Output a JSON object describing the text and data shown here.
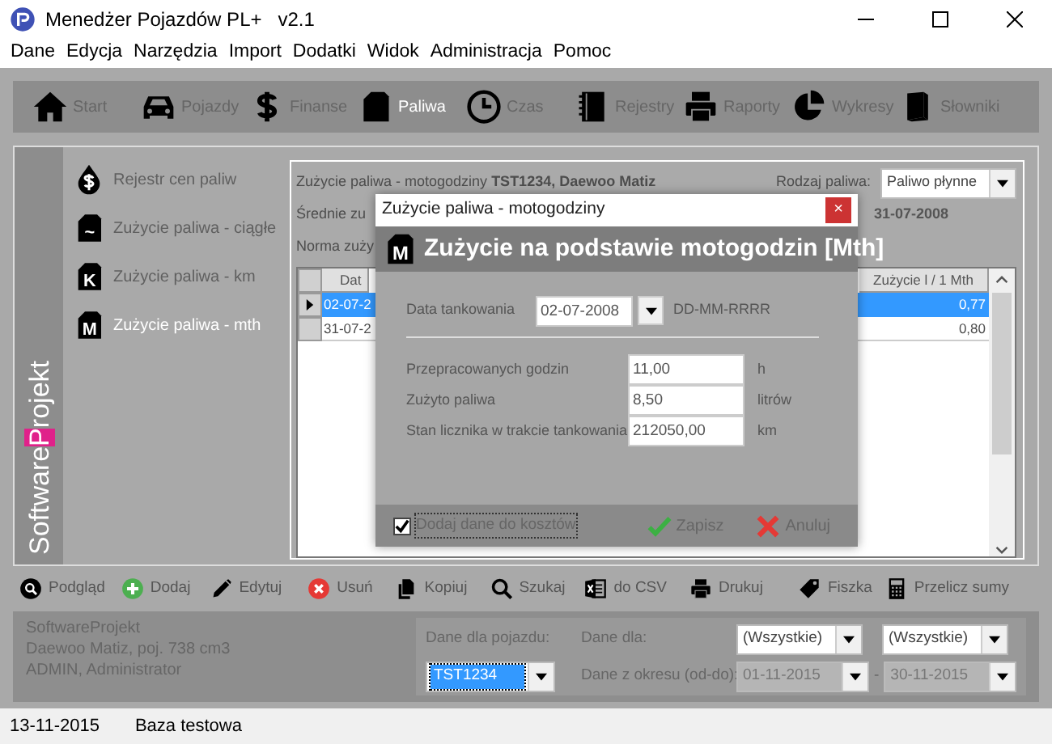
{
  "window": {
    "title": "Menedżer Pojazdów PL+",
    "version": "v2.1"
  },
  "menu": [
    "Dane",
    "Edycja",
    "Narzędzia",
    "Import",
    "Dodatki",
    "Widok",
    "Administracja",
    "Pomoc"
  ],
  "toolbar": [
    {
      "label": "Start",
      "selected": false
    },
    {
      "label": "Pojazdy",
      "selected": false
    },
    {
      "label": "Finanse",
      "selected": false
    },
    {
      "label": "Paliwa",
      "selected": true
    },
    {
      "label": "Czas",
      "selected": false
    },
    {
      "label": "Rejestry",
      "selected": false
    },
    {
      "label": "Raporty",
      "selected": false
    },
    {
      "label": "Wykresy",
      "selected": false
    },
    {
      "label": "Słowniki",
      "selected": false
    }
  ],
  "brand": [
    {
      "text": "Software",
      "highlight": false
    },
    {
      "text": "P",
      "highlight": true
    },
    {
      "text": "rojekt",
      "highlight": false
    }
  ],
  "sidebar": {
    "items": [
      {
        "label": "Rejestr cen paliw",
        "selected": false
      },
      {
        "label": "Zużycie paliwa - ciągłe",
        "icon_text": "~",
        "selected": false
      },
      {
        "label": "Zużycie paliwa - km",
        "icon_text": "K",
        "selected": false
      },
      {
        "label": "Zużycie paliwa - mth",
        "icon_text": "M",
        "selected": true
      }
    ]
  },
  "panel": {
    "heading": "Zużycie paliwa - motogodziny **TST1234, Daewoo Matiz**",
    "fuel_label": "Rodzaj paliwa:",
    "fuel_value": "Paliwo płynne",
    "line_2": "Średnie zu",
    "line_2_end": "31-07-2008",
    "line_3": "Norma zuży",
    "table": {
      "columns": [
        "Dat",
        "Zużycie l / 1 Mth"
      ],
      "rows": [
        {
          "cells": [
            "02-07-2",
            "0,77"
          ],
          "selected": true
        },
        {
          "cells": [
            "31-07-2",
            "0,80"
          ],
          "selected": false
        }
      ]
    }
  },
  "dialog": {
    "title": "Zużycie paliwa - motogodziny",
    "close": "×",
    "icon_text": "M",
    "heading": "Zużycie na podstawie motogodzin [Mth]",
    "date": {
      "label": "Data tankowania",
      "value": "02-07-2008",
      "hint": "DD-MM-RRRR"
    },
    "fields": [
      {
        "label": "Przepracowanych godzin",
        "value": "11,00",
        "unit": "h"
      },
      {
        "label": "Zużyto paliwa",
        "value": "8,50",
        "unit": "litrów"
      },
      {
        "label": "Stan licznika w trakcie tankowania",
        "value": "212050,00",
        "unit": "km"
      }
    ],
    "add_to_costs": {
      "label": "Dodaj dane do kosztów",
      "checked": true
    },
    "buttons": [
      {
        "label": "Zapisz",
        "kind": "save"
      },
      {
        "label": "Anuluj",
        "kind": "cancel"
      }
    ]
  },
  "actions": [
    "Podgląd",
    "Dodaj",
    "Edytuj",
    "Usuń",
    "Kopiuj",
    "Szukaj",
    "do CSV",
    "Drukuj",
    "Fiszka",
    "Przelicz sumy"
  ],
  "info": [
    "SoftwareProjekt",
    "Daewoo Matiz, poj. 738 cm3",
    "ADMIN, Administrator"
  ],
  "filters": {
    "vehicle_label": "Dane dla pojazdu:",
    "vehicle": "TST1234",
    "for_label": "Dane dla:",
    "for_1": "(Wszystkie)",
    "for_2": "(Wszystkie)",
    "period_label": "Dane z okresu (od-do):",
    "from": "01-11-2015",
    "separator": "-",
    "to": "30-11-2015"
  },
  "status_bar": [
    "13-11-2015",
    "Baza testowa"
  ]
}
